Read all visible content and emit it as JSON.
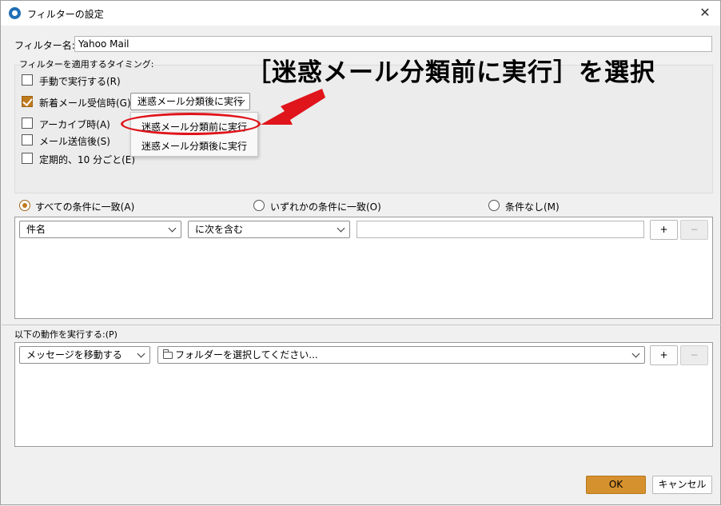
{
  "window": {
    "title": "フィルターの設定"
  },
  "filter_name": {
    "label": "フィルター名:(I)",
    "value": "Yahoo Mail"
  },
  "timing": {
    "heading": "フィルターを適用するタイミング:",
    "manual": {
      "label": "手動で実行する(R)",
      "checked": false
    },
    "new_mail": {
      "label": "新着メール受信時(G):",
      "checked": true,
      "selected": "迷惑メール分類後に実行"
    },
    "archive": {
      "label": "アーカイブ時(A)",
      "checked": false
    },
    "after_send": {
      "label": "メール送信後(S)",
      "checked": false
    },
    "periodic": {
      "label": "定期的、10 分ごと(E)",
      "checked": false
    },
    "popup_options": [
      "迷惑メール分類前に実行",
      "迷惑メール分類後に実行"
    ]
  },
  "annotation": {
    "text": "［迷惑メール分類前に実行］を選択",
    "color": "#e0141b"
  },
  "match": {
    "all": "すべての条件に一致(A)",
    "any": "いずれかの条件に一致(O)",
    "none": "条件なし(M)",
    "selected": "all"
  },
  "condition": {
    "field": "件名",
    "operator": "に次を含む",
    "value": "",
    "add": "+",
    "remove": "−"
  },
  "actions": {
    "heading": "以下の動作を実行する:(P)",
    "action": "メッセージを移動する",
    "folder": "フォルダーを選択してください...",
    "add": "+",
    "remove": "−"
  },
  "buttons": {
    "ok": "OK",
    "cancel": "キャンセル"
  },
  "colors": {
    "accent": "#c07a1e",
    "ok_button": "#d6912f"
  }
}
